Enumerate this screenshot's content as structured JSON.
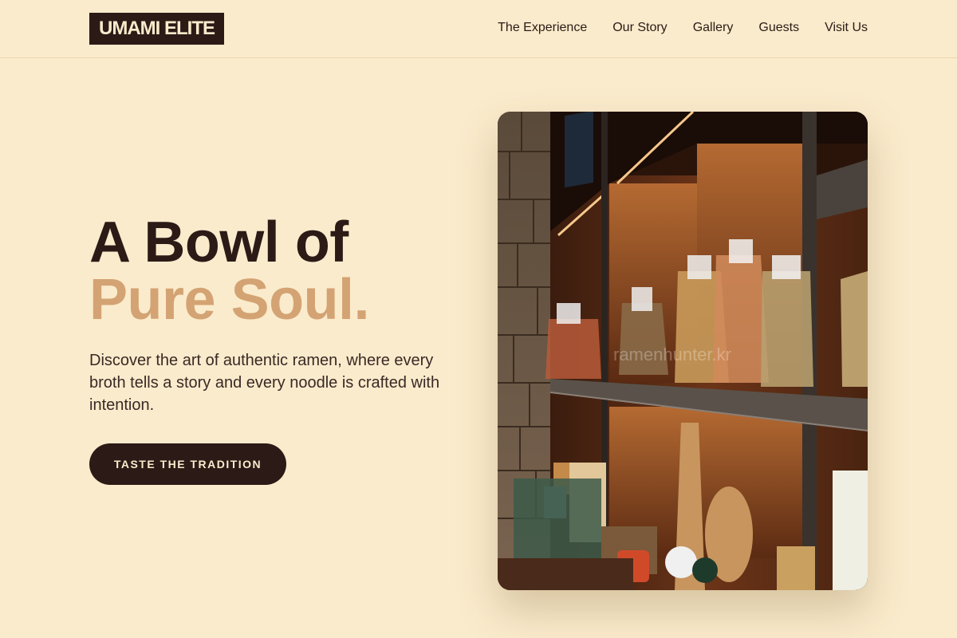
{
  "header": {
    "logo": "UMAMI ELITE",
    "nav": [
      {
        "label": "The Experience"
      },
      {
        "label": "Our Story"
      },
      {
        "label": "Gallery"
      },
      {
        "label": "Guests"
      },
      {
        "label": "Visit Us"
      }
    ]
  },
  "hero": {
    "title_line1": "A Bowl of",
    "title_line2": "Pure Soul.",
    "description": "Discover the art of authentic ramen, where every broth tells a story and every noodle is crafted with intention.",
    "cta_label": "TASTE THE TRADITION",
    "image": {
      "watermark": "ramenhunter.kr"
    }
  },
  "colors": {
    "background": "#faebcc",
    "text_dark": "#2b1a16",
    "accent": "#d4a373"
  }
}
